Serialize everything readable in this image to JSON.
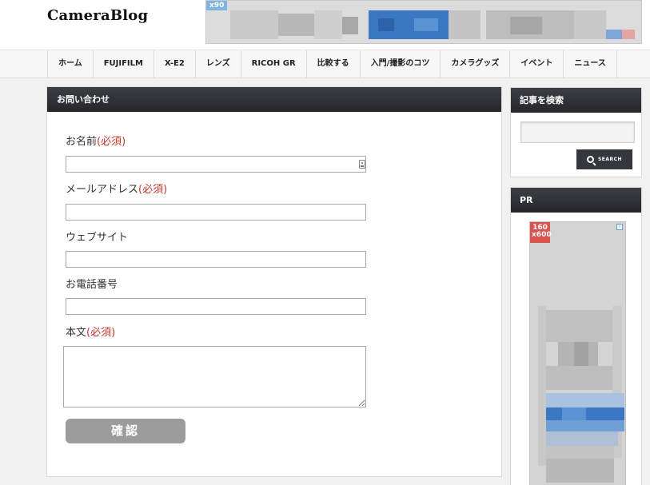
{
  "header": {
    "site_title": "CameraBlog",
    "ad_tag": "x90"
  },
  "nav": {
    "items": [
      "ホーム",
      "FUJIFILM",
      "X-E2",
      "レンズ",
      "RICOH GR",
      "比較する",
      "入門/撮影のコツ",
      "カメラグッズ",
      "イベント",
      "ニュース"
    ]
  },
  "form": {
    "heading": "お問い合わせ",
    "required_mark": "(必須)",
    "name_label": "お名前",
    "email_label": "メールアドレス",
    "website_label": "ウェブサイト",
    "phone_label": "お電話番号",
    "body_label": "本文",
    "name_value": "",
    "email_value": "",
    "website_value": "",
    "phone_value": "",
    "body_value": "",
    "confirm_label": "確認"
  },
  "sidebar": {
    "search_heading": "記事を検索",
    "search_value": "",
    "search_button_label": "SEARCH",
    "pr_heading": "PR",
    "pr_ad_tag_line1": "160",
    "pr_ad_tag_line2": "x600",
    "ad_info_glyph": "i"
  },
  "colors": {
    "required": "#c0392b",
    "heading_bg": "#2e3034",
    "confirm_button": "#9c9c9c",
    "search_button": "#34373b",
    "ad_blue": "#3b78c4"
  },
  "icons": {
    "contact_autofill": "contact-card-icon",
    "search": "magnifier-icon",
    "ad_info": "info-icon"
  }
}
